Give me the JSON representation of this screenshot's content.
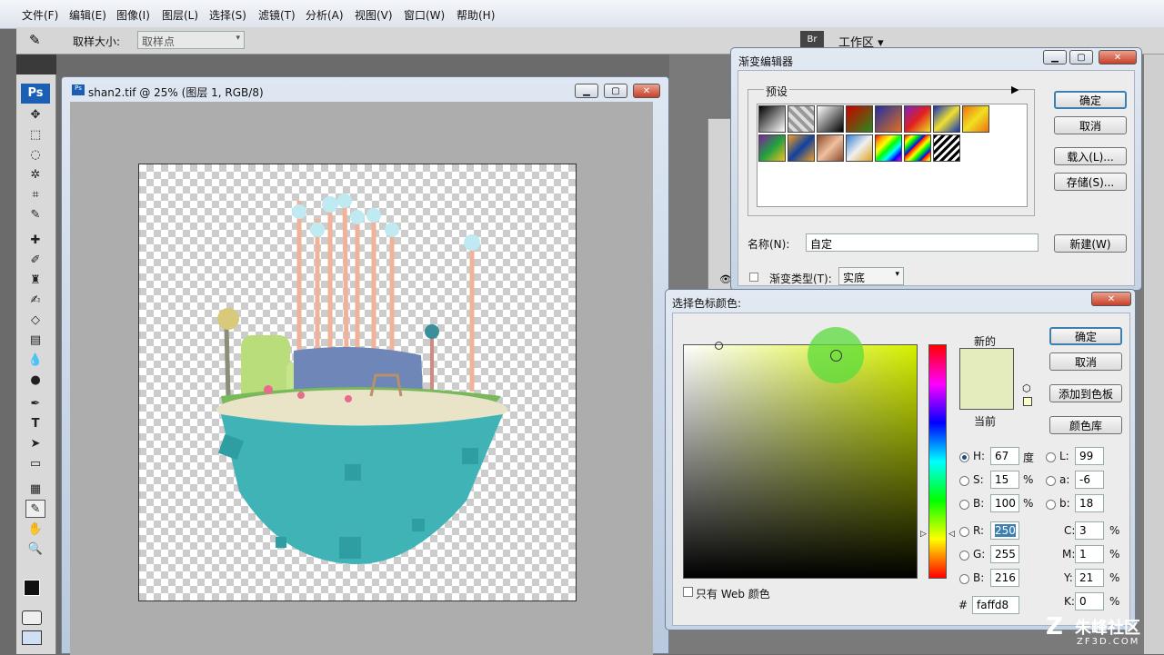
{
  "menu": [
    "文件(F)",
    "编辑(E)",
    "图像(I)",
    "图层(L)",
    "选择(S)",
    "滤镜(T)",
    "分析(A)",
    "视图(V)",
    "窗口(W)",
    "帮助(H)"
  ],
  "options": {
    "sample_label": "取样大小:",
    "sample_value": "取样点",
    "workspace": "工作区 ▾"
  },
  "ps_logo": "Ps",
  "document": {
    "title": "shan2.tif @ 25% (图层 1, RGB/8)"
  },
  "gradient_editor": {
    "title": "渐变编辑器",
    "presets_label": "预设",
    "ok": "确定",
    "cancel": "取消",
    "load": "载入(L)...",
    "save": "存储(S)...",
    "name_label": "名称(N):",
    "name_value": "自定",
    "new": "新建(W)",
    "type_label": "渐变类型(T):",
    "type_value": "实底"
  },
  "color_picker": {
    "title": "选择色标颜色:",
    "new_label": "新的",
    "current_label": "当前",
    "ok": "确定",
    "cancel": "取消",
    "add_swatch": "添加到色板",
    "libraries": "颜色库",
    "web_only": "只有 Web 颜色",
    "H": "67",
    "S": "15",
    "Bv": "100",
    "R": "250",
    "G": "255",
    "B": "216",
    "L": "99",
    "a": "-6",
    "b": "18",
    "C": "3",
    "M": "1",
    "Y": "21",
    "K": "0",
    "hex": "faffd8",
    "deg": "度",
    "pct": "%",
    "hash": "#",
    "field_labels": {
      "H": "H:",
      "S": "S:",
      "Bv": "B:",
      "R": "R:",
      "G": "G:",
      "B": "B:",
      "L": "L:",
      "a": "a:",
      "b": "b:",
      "C": "C:",
      "M": "M:",
      "Y": "Y:",
      "K": "K:"
    }
  },
  "watermark": {
    "text": "朱峰社区",
    "sub": "ZF3D.COM"
  },
  "colors": {
    "new_color": "#e4ebbd",
    "hue_field": "#d5f000",
    "accent": "#3c7fb1"
  }
}
